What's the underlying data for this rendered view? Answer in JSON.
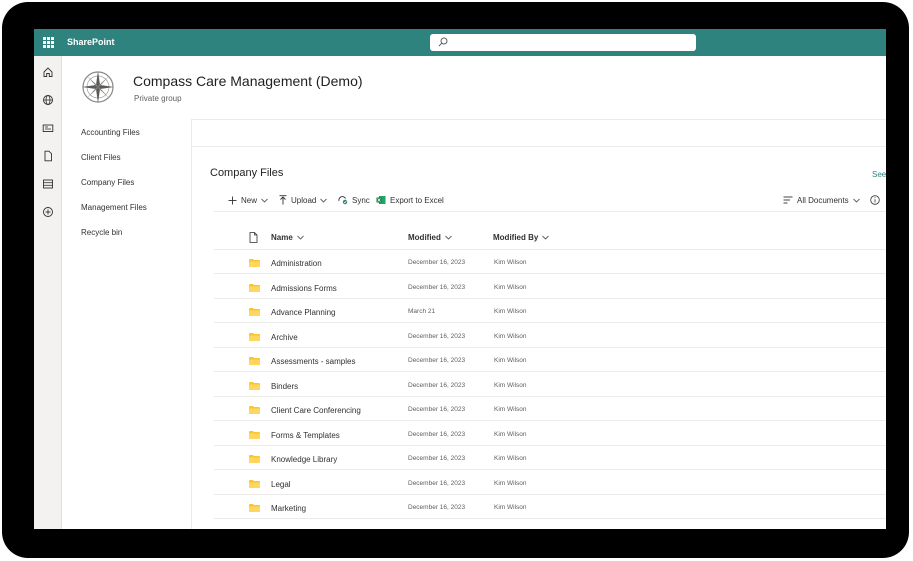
{
  "suitebar": {
    "app_name": "SharePoint",
    "search_placeholder": "",
    "color": "#2f837e"
  },
  "rail": {
    "icons": [
      "home-icon",
      "globe-icon",
      "news-icon",
      "file-icon",
      "list-icon",
      "add-icon"
    ]
  },
  "site": {
    "title": "Compass Care Management (Demo)",
    "subtitle": "Private group",
    "logo_icon": "compass-rose-icon"
  },
  "nav": {
    "items": [
      {
        "label": "Accounting Files"
      },
      {
        "label": "Client Files"
      },
      {
        "label": "Company Files"
      },
      {
        "label": "Management Files"
      },
      {
        "label": "Recycle bin"
      }
    ]
  },
  "library": {
    "title": "Company Files",
    "see_all": "See"
  },
  "commands": {
    "new_label": "New",
    "upload_label": "Upload",
    "sync_label": "Sync",
    "export_label": "Export to Excel",
    "view_label": "All Documents"
  },
  "table": {
    "columns": {
      "name": "Name",
      "modified": "Modified",
      "modified_by": "Modified By"
    },
    "rows": [
      {
        "name": "Administration",
        "modified": "December 16, 2023",
        "modified_by": "Kim Wilson"
      },
      {
        "name": "Admissions Forms",
        "modified": "December 16, 2023",
        "modified_by": "Kim Wilson"
      },
      {
        "name": "Advance Planning",
        "modified": "March 21",
        "modified_by": "Kim Wilson"
      },
      {
        "name": "Archive",
        "modified": "December 16, 2023",
        "modified_by": "Kim Wilson"
      },
      {
        "name": "Assessments - samples",
        "modified": "December 16, 2023",
        "modified_by": "Kim Wilson"
      },
      {
        "name": "Binders",
        "modified": "December 16, 2023",
        "modified_by": "Kim Wilson"
      },
      {
        "name": "Client Care Conferencing",
        "modified": "December 16, 2023",
        "modified_by": "Kim Wilson"
      },
      {
        "name": "Forms & Templates",
        "modified": "December 16, 2023",
        "modified_by": "Kim Wilson"
      },
      {
        "name": "Knowledge Library",
        "modified": "December 16, 2023",
        "modified_by": "Kim Wilson"
      },
      {
        "name": "Legal",
        "modified": "December 16, 2023",
        "modified_by": "Kim Wilson"
      },
      {
        "name": "Marketing",
        "modified": "December 16, 2023",
        "modified_by": "Kim Wilson"
      }
    ]
  }
}
